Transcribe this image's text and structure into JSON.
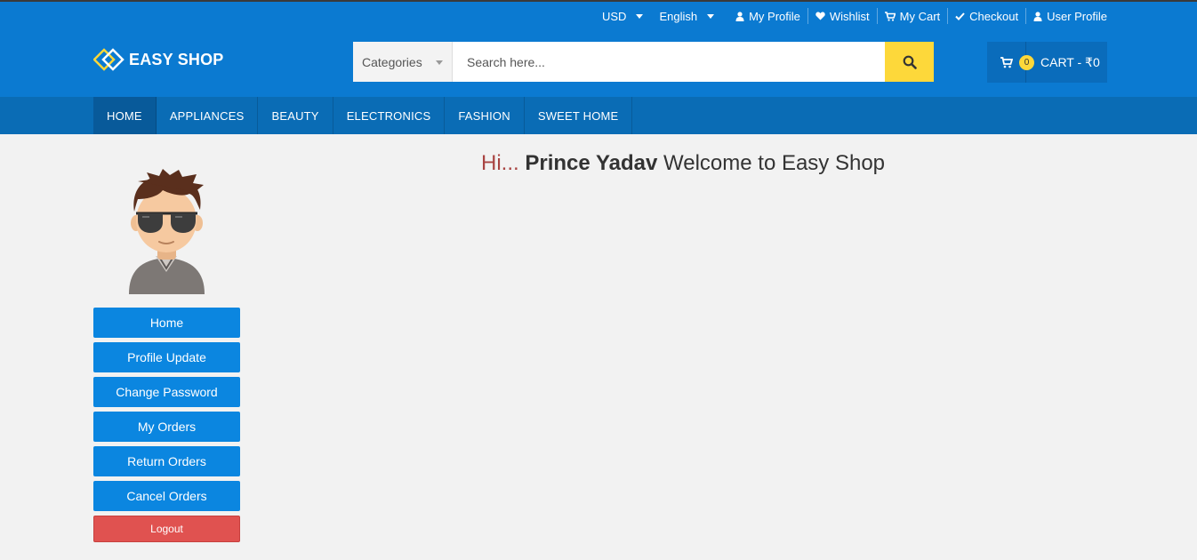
{
  "topbar": {
    "currency": "USD",
    "language": "English",
    "links": [
      {
        "icon": "user-icon",
        "label": "My Profile"
      },
      {
        "icon": "heart-icon",
        "label": "Wishlist"
      },
      {
        "icon": "cart-icon",
        "label": "My Cart"
      },
      {
        "icon": "check-icon",
        "label": "Checkout"
      },
      {
        "icon": "user-icon",
        "label": "User Profile"
      }
    ]
  },
  "brand": {
    "name": "EASY SHOP"
  },
  "search": {
    "category": "Categories",
    "placeholder": "Search here..."
  },
  "cart": {
    "count": "0",
    "label": "CART - ₹0"
  },
  "nav": {
    "items": [
      "HOME",
      "APPLIANCES",
      "BEAUTY",
      "ELECTRONICS",
      "FASHION",
      "SWEET HOME"
    ],
    "active": "HOME"
  },
  "welcome": {
    "greeting": "Hi...",
    "name": "Prince Yadav",
    "message": "Welcome to Easy Shop"
  },
  "sidebar": {
    "items": [
      "Home",
      "Profile Update",
      "Change Password",
      "My Orders",
      "Return Orders",
      "Cancel Orders"
    ],
    "logout": "Logout"
  },
  "colors": {
    "header": "#0b7ad1",
    "nav": "#0a6cb5",
    "search_button": "#fdd83a",
    "sidebar_button": "#0b86e0",
    "logout_button": "#e05250",
    "greeting": "#a94442"
  }
}
